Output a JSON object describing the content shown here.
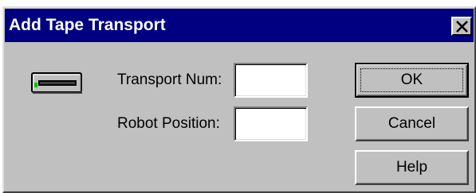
{
  "dialog": {
    "title": "Add Tape Transport"
  },
  "icons": {
    "close": "close-icon",
    "device": "tape-drive-icon"
  },
  "form": {
    "transport_num_label": "Transport Num:",
    "transport_num_value": "",
    "robot_position_label": "Robot Position:",
    "robot_position_value": ""
  },
  "buttons": {
    "ok_label": "OK",
    "cancel_label": "Cancel",
    "help_label": "Help"
  },
  "colors": {
    "titlebar": "#000080",
    "face": "#c0c0c0",
    "title_text": "#ffffff"
  }
}
